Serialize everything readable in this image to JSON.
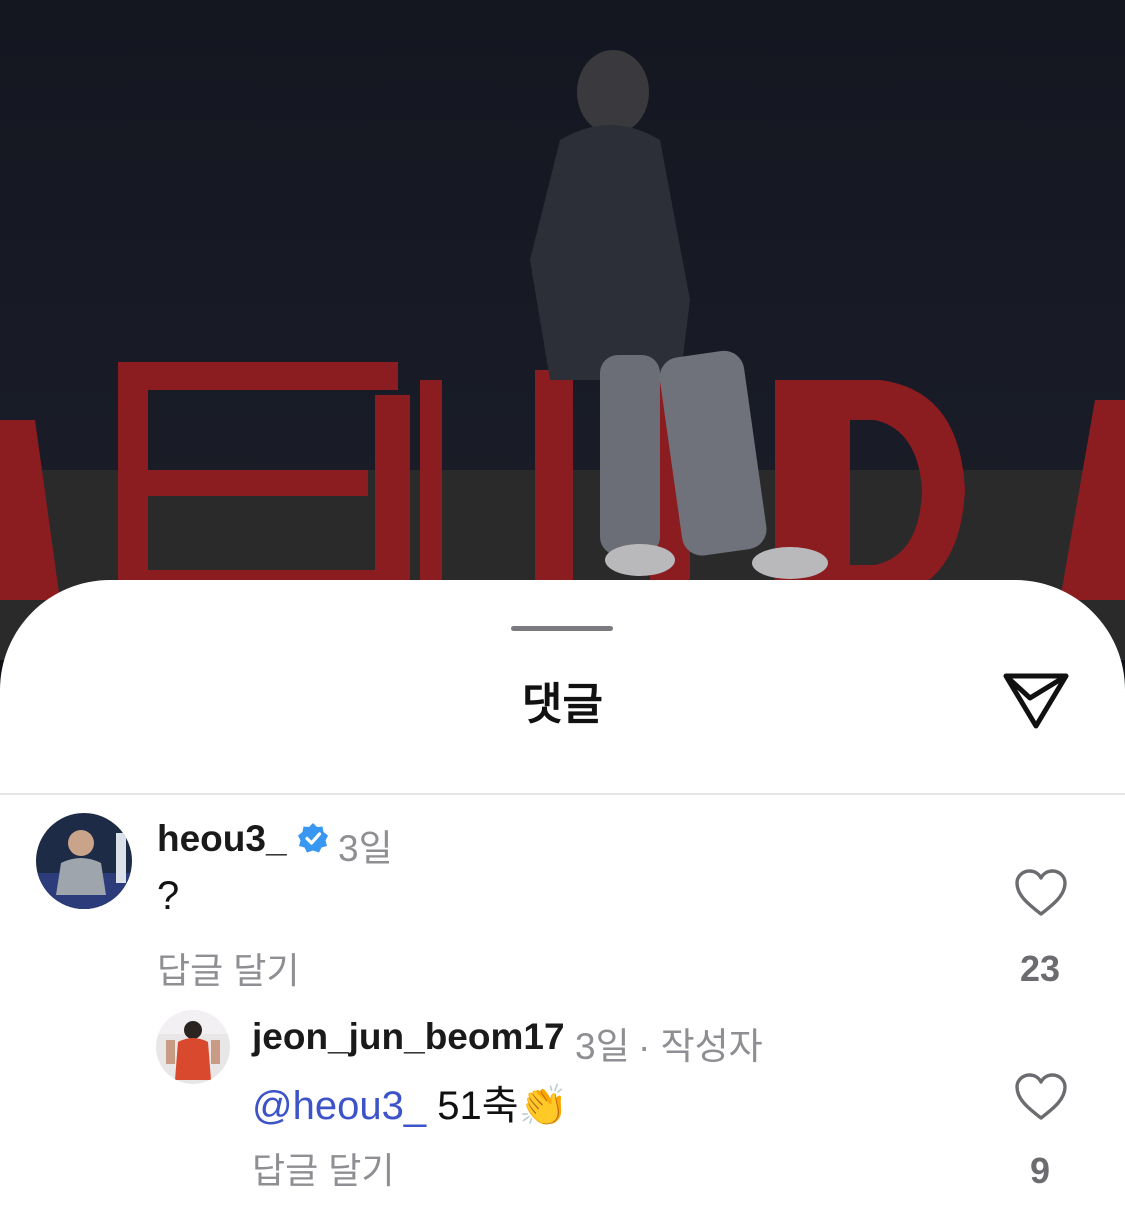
{
  "sheet": {
    "title": "댓글",
    "share_icon": "send-icon"
  },
  "comments": [
    {
      "username": "heou3_",
      "verified": true,
      "time": "3일",
      "text": "?",
      "reply_label": "답글 달기",
      "like_count": "23",
      "avatar_icon": "profile-photo"
    },
    {
      "username": "jeon_jun_beom17",
      "time": "3일",
      "author_badge": "· 작성자",
      "mention": "@heou3_",
      "text": "51축",
      "emoji": "👏",
      "reply_label": "답글 달기",
      "like_count": "9",
      "avatar_icon": "profile-photo"
    }
  ],
  "colors": {
    "mention": "#3d54c8",
    "verified": "#3897f0",
    "sign_letters": "#8b1c20"
  }
}
